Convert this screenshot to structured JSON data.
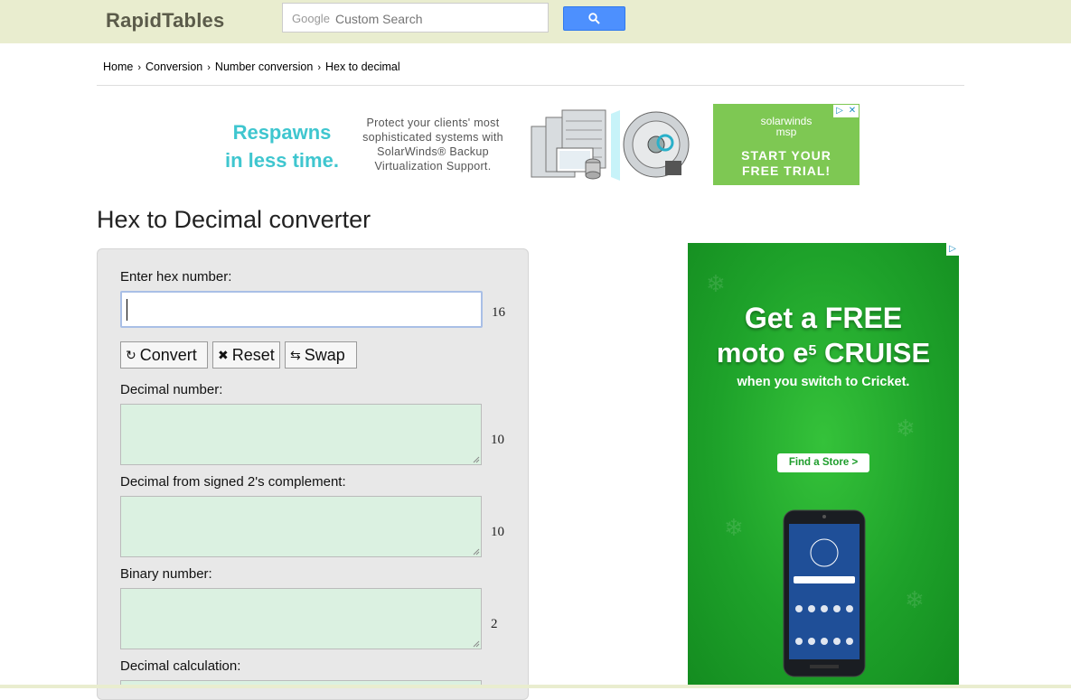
{
  "header": {
    "logo": "RapidTables",
    "search_brand": "Google",
    "search_placeholder": "Custom Search"
  },
  "breadcrumb": [
    "Home",
    "Conversion",
    "Number conversion",
    "Hex to decimal"
  ],
  "ad_banner": {
    "headline_1": "Respawns",
    "headline_2": "in less time.",
    "description": "Protect your clients' most sophisticated systems with SolarWinds® Backup Virtualization Support.",
    "brand_1": "solarwinds",
    "brand_2": "msp",
    "cta_1": "START YOUR",
    "cta_2": "FREE TRIAL!"
  },
  "page": {
    "title": "Hex to Decimal converter"
  },
  "converter": {
    "hex_label": "Enter hex number:",
    "hex_value": "",
    "hex_base": "16",
    "buttons": {
      "convert": "Convert",
      "reset": "Reset",
      "swap": "Swap"
    },
    "decimal_label": "Decimal number:",
    "decimal_base": "10",
    "signed_label": "Decimal from signed 2's complement:",
    "signed_base": "10",
    "binary_label": "Binary number:",
    "binary_base": "2",
    "calc_label": "Decimal calculation:"
  },
  "ad_side": {
    "line1": "Get a FREE",
    "line2_a": "moto e",
    "line2_sup": "5",
    "line2_b": " CRUISE",
    "line3": "when you switch to Cricket.",
    "store_btn": "Find a Store >"
  },
  "colors": {
    "header_bg": "#e9edcf",
    "output_bg": "#dbf1e1",
    "panel_bg": "#e8e8e8",
    "search_button": "#4d90fe",
    "ad_green": "#1ea22a",
    "ad_cta_green": "#7ec853",
    "ad_text_teal": "#3fc6cf"
  }
}
